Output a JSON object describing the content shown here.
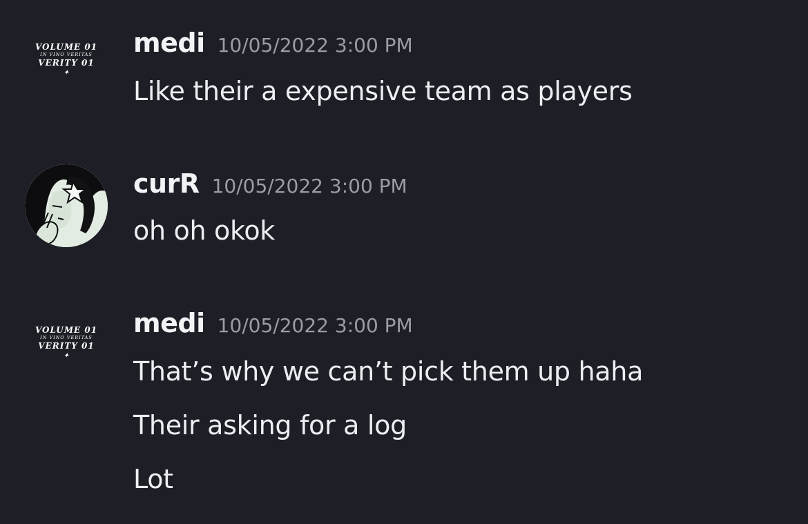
{
  "messages": [
    {
      "username": "medi",
      "timestamp": "10/05/2022 3:00 PM",
      "avatar": {
        "type": "text-logo",
        "line1": "VOLUME 01",
        "line2": "IN VINO VERITAS",
        "line3": "VERITY 01",
        "glyph": "✦"
      },
      "lines": [
        "Like their a expensive team as players"
      ]
    },
    {
      "username": "curR",
      "timestamp": "10/05/2022 3:00 PM",
      "avatar": {
        "type": "illustration"
      },
      "lines": [
        "oh oh okok"
      ]
    },
    {
      "username": "medi",
      "timestamp": "10/05/2022 3:00 PM",
      "avatar": {
        "type": "text-logo",
        "line1": "VOLUME 01",
        "line2": "IN VINO VERITAS",
        "line3": "VERITY 01",
        "glyph": "✦"
      },
      "lines": [
        "That’s why we can’t pick them up haha",
        "Their asking for a log",
        "Lot"
      ]
    }
  ],
  "colors": {
    "background": "#1e1f26",
    "username": "#f2f3f5",
    "timestamp": "#9a9ca7",
    "message": "#eceef2"
  }
}
